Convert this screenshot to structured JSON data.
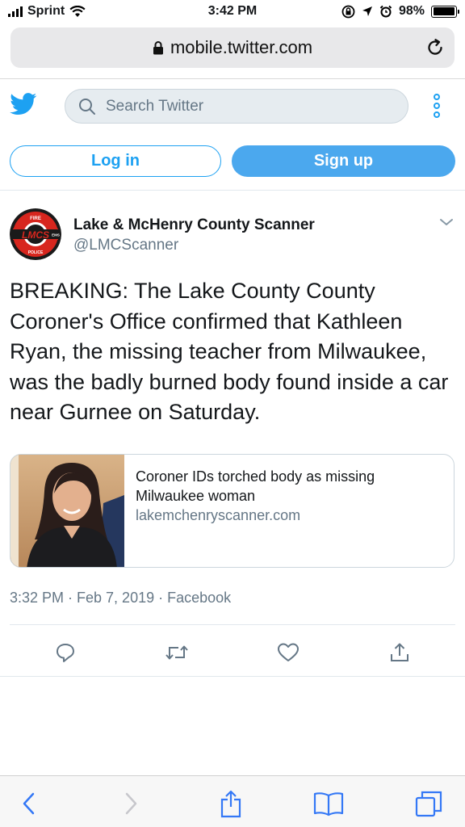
{
  "status_bar": {
    "carrier": "Sprint",
    "time": "3:42 PM",
    "battery": "98%",
    "battery_level": 0.98
  },
  "browser": {
    "url": "mobile.twitter.com"
  },
  "header": {
    "search_placeholder": "Search Twitter",
    "login_label": "Log in",
    "signup_label": "Sign up"
  },
  "tweet": {
    "display_name": "Lake & McHenry County Scanner",
    "handle": "@LMCScanner",
    "text": "BREAKING: The Lake County County Coroner's Office confirmed that Kathleen Ryan, the missing teacher from Milwaukee, was the badly burned body found inside a car near Gurnee on Saturday.",
    "card": {
      "title": "Coroner IDs torched body as missing Milwaukee woman",
      "domain": "lakemchenryscanner.com"
    },
    "timestamp": "3:32 PM · Feb 7, 2019 · Facebook"
  },
  "avatar_logo": {
    "text_top": "FIRE",
    "text_center": "LMCS",
    "text_right": "EMS",
    "text_bottom": "POLICE"
  },
  "colors": {
    "twitter_blue": "#1da1f2",
    "signup_bg": "#4ba8ee",
    "secondary_text": "#657786",
    "safari_tint": "#3478f6"
  },
  "icons": {
    "reply": "reply-icon",
    "retweet": "retweet-icon",
    "like": "heart-icon",
    "share": "share-icon"
  }
}
